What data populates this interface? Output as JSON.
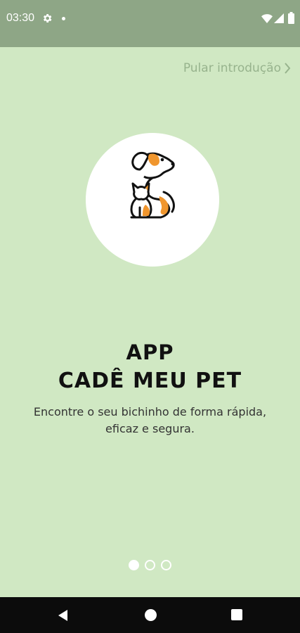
{
  "status_bar": {
    "time": "03:30",
    "icons": [
      "gear-icon",
      "notification-dot-icon",
      "wifi-icon",
      "signal-icon",
      "battery-icon"
    ]
  },
  "onboarding": {
    "skip_label": "Pular introdução",
    "title_line1": "APP",
    "title_line2": "CADÊ MEU PET",
    "subtitle_line1": "Encontre o seu bichinho de forma rápida,",
    "subtitle_line2": "eficaz e segura.",
    "page_indicator": {
      "total": 3,
      "current": 1
    }
  },
  "colors": {
    "background": "#d0e8c3",
    "status_bar": "#8ea686",
    "accent_orange": "#f0962e",
    "skip_text": "#97b38d"
  },
  "nav_bar": {
    "icons": [
      "back-icon",
      "home-icon",
      "recents-icon"
    ]
  }
}
